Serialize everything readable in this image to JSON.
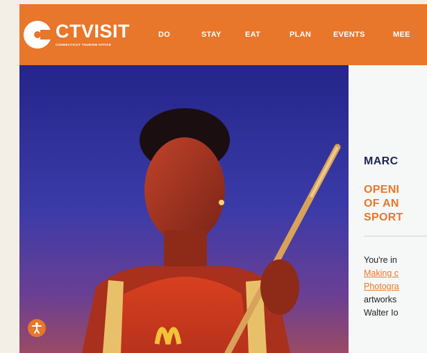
{
  "brand": {
    "name": "CTVISIT",
    "tagline": "CONNECTICUT TOURISM OFFICE",
    "accent": "#e8762b",
    "navy": "#1c2551"
  },
  "nav": {
    "items": [
      {
        "label": "DO"
      },
      {
        "label": "STAY"
      },
      {
        "label": "EAT"
      },
      {
        "label": "PLAN"
      },
      {
        "label": "EVENTS"
      },
      {
        "label": "MEE"
      }
    ]
  },
  "hero": {
    "image_icon": "athlete-photo"
  },
  "article": {
    "date": "MARC",
    "heading_lines": [
      "OPENI",
      "OF AN",
      "SPORT"
    ],
    "body_lines": [
      "You're in",
      "Making c",
      "Photogra",
      "artworks",
      "Walter Io"
    ]
  },
  "accessibility": {
    "icon": "accessibility-icon"
  }
}
